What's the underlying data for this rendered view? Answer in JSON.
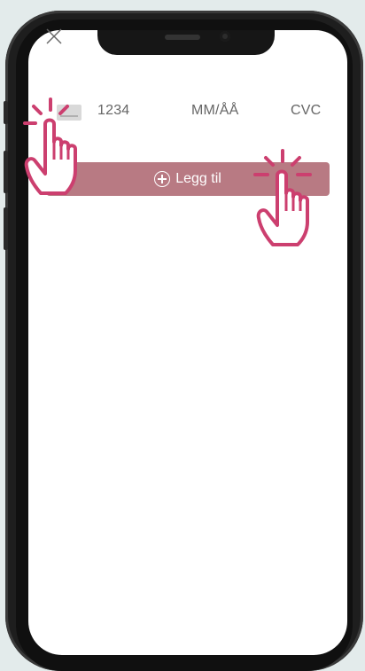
{
  "form": {
    "close_icon": "close-icon",
    "card_number_placeholder": "1234",
    "expiry_placeholder": "MM/ÅÅ",
    "cvc_placeholder": "CVC",
    "add_label": "Legg til",
    "add_icon": "plus-circle-icon"
  },
  "colors": {
    "accent": "#b87a83",
    "tap_hint": "#cc3f6f"
  }
}
